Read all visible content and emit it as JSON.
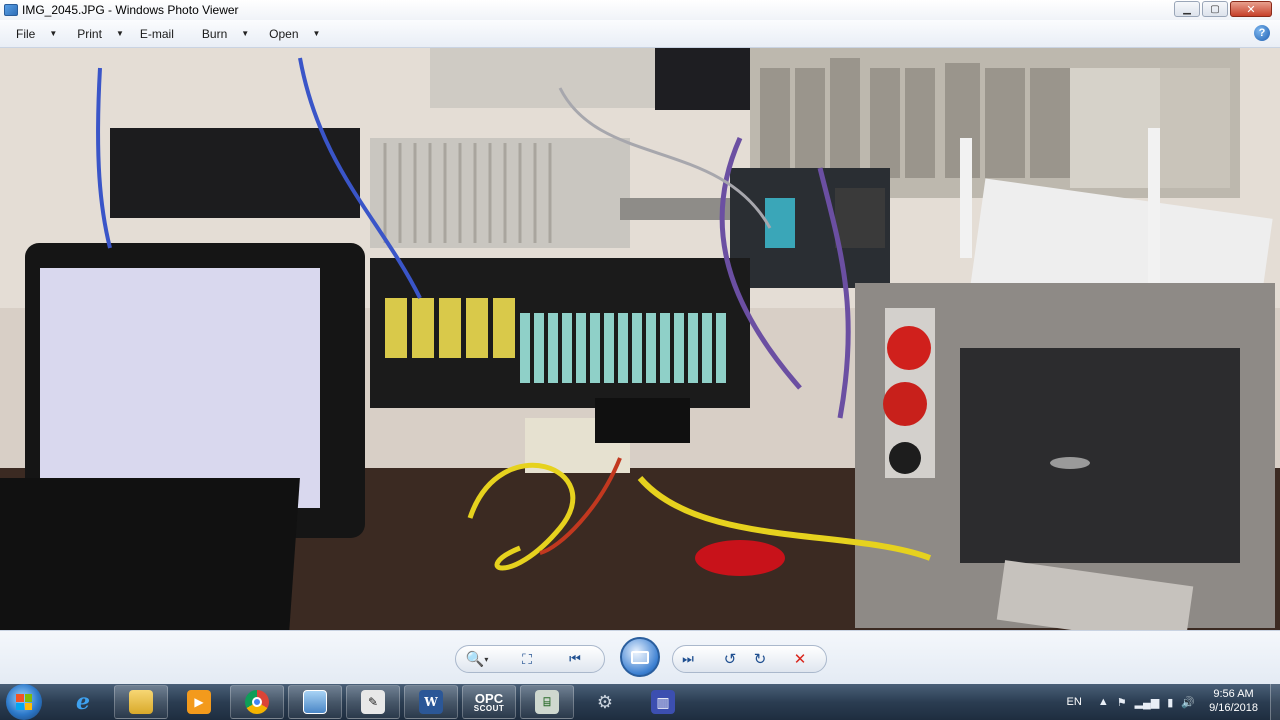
{
  "window": {
    "title": "IMG_2045.JPG - Windows Photo Viewer",
    "minimize_icon": "minimize-icon",
    "maximize_icon": "maximize-icon",
    "close_icon": "close-icon"
  },
  "menu": {
    "items": [
      {
        "label": "File"
      },
      {
        "label": "Print"
      },
      {
        "label": "E-mail"
      },
      {
        "label": "Burn"
      },
      {
        "label": "Open"
      }
    ],
    "help_icon": "help-icon"
  },
  "photo": {
    "description_icon": "photo-image"
  },
  "controls": {
    "zoom_icon": "zoom-icon",
    "actual_size_icon": "actual-size-icon",
    "previous_icon": "previous-icon",
    "slideshow_icon": "slideshow-icon",
    "next_icon": "next-icon",
    "rotate_ccw_icon": "rotate-counterclockwise-icon",
    "rotate_cw_icon": "rotate-clockwise-icon",
    "delete_icon": "delete-icon",
    "delete_color": "#d9261c"
  },
  "taskbar": {
    "apps": [
      {
        "name": "internet-explorer"
      },
      {
        "name": "file-explorer"
      },
      {
        "name": "media-player"
      },
      {
        "name": "chrome"
      },
      {
        "name": "photo-viewer"
      },
      {
        "name": "engineering-tool"
      },
      {
        "name": "word"
      },
      {
        "name": "opc-scout",
        "line1": "OPC",
        "line2": "SCOUT"
      },
      {
        "name": "network-tool"
      },
      {
        "name": "settings-tool"
      },
      {
        "name": "io-tool"
      }
    ],
    "tray": {
      "language": "EN",
      "time": "9:56 AM",
      "date": "9/16/2018"
    }
  }
}
